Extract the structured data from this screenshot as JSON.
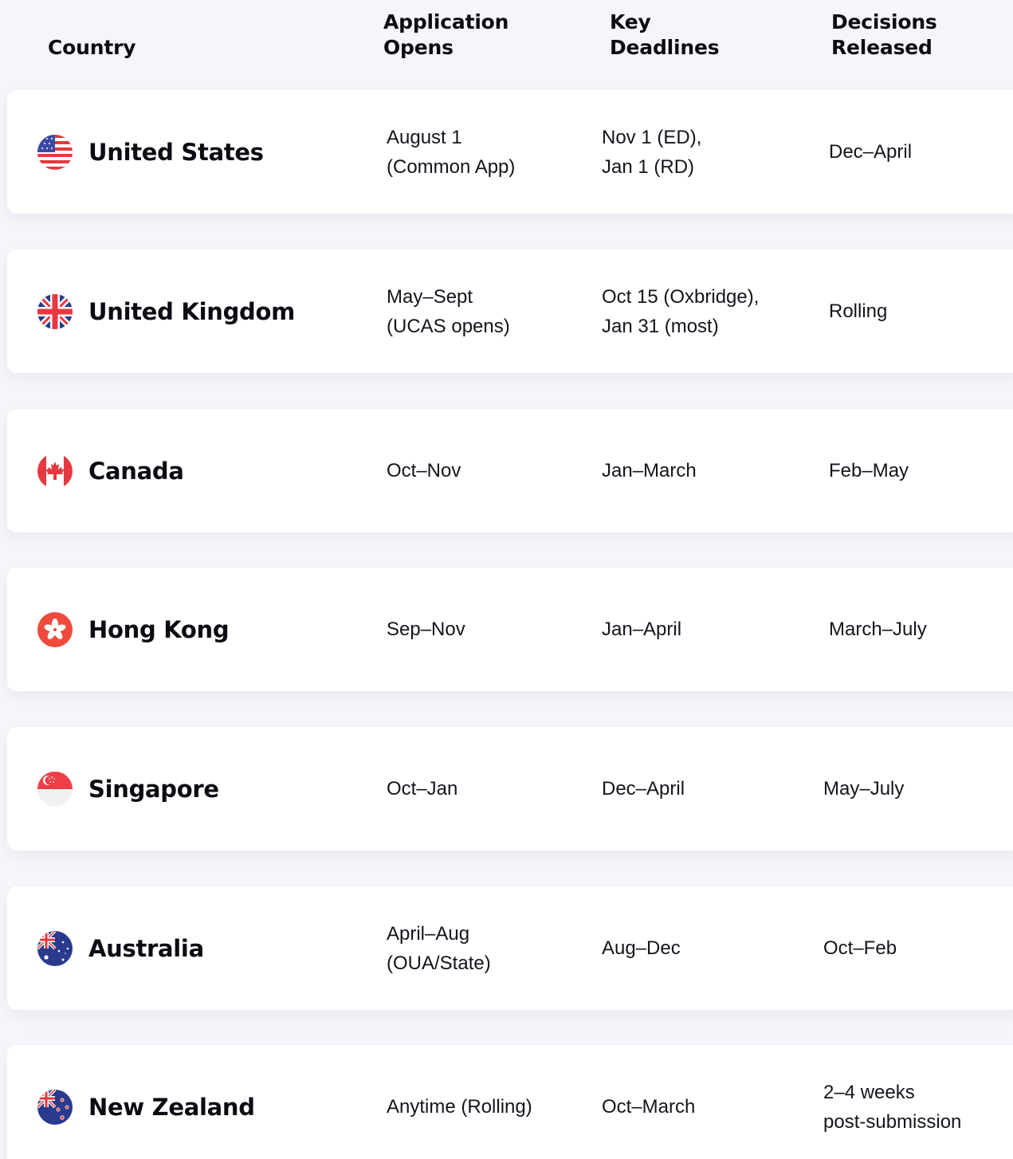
{
  "header": {
    "country": "Country",
    "opens": "Application\nOpens",
    "deadlines": "Key\nDeadlines",
    "decisions": "Decisions\nReleased"
  },
  "rows": [
    {
      "country": "United States",
      "flag_icon": "us-flag-icon",
      "opens": "August 1\n(Common App)",
      "deadlines": "Nov 1 (ED),\nJan 1 (RD)",
      "decisions": "Dec–April"
    },
    {
      "country": "United Kingdom",
      "flag_icon": "uk-flag-icon",
      "opens": "May–Sept\n(UCAS opens)",
      "deadlines": "Oct 15 (Oxbridge),\nJan 31 (most)",
      "decisions": "Rolling"
    },
    {
      "country": "Canada",
      "flag_icon": "canada-flag-icon",
      "opens": "Oct–Nov",
      "deadlines": "Jan–March",
      "decisions": "Feb–May"
    },
    {
      "country": "Hong Kong",
      "flag_icon": "hong-kong-flag-icon",
      "opens": "Sep–Nov",
      "deadlines": "Jan–April",
      "decisions": "March–July"
    },
    {
      "country": "Singapore",
      "flag_icon": "singapore-flag-icon",
      "opens": "Oct–Jan",
      "deadlines": "Dec–April",
      "decisions": "May–July"
    },
    {
      "country": "Australia",
      "flag_icon": "australia-flag-icon",
      "opens": "April–Aug\n(OUA/State)",
      "deadlines": "Aug–Dec",
      "decisions": "Oct–Feb"
    },
    {
      "country": "New Zealand",
      "flag_icon": "new-zealand-flag-icon",
      "opens": "Anytime (Rolling)",
      "deadlines": "Oct–March",
      "decisions": "2–4 weeks\npost-submission"
    }
  ],
  "colors": {
    "background": "#f5f6fb",
    "card": "#ffffff",
    "text": "#0b0b12",
    "flag_red": "#e6393f",
    "flag_blue": "#2a3a8c"
  }
}
